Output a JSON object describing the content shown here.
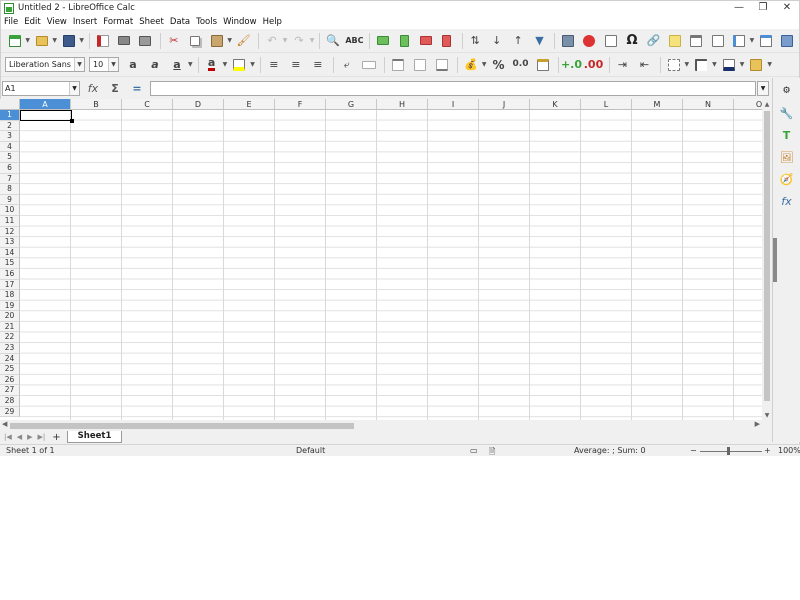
{
  "window": {
    "title": "Untitled 2 - LibreOffice Calc",
    "controls": [
      "—",
      "❐",
      "✕"
    ]
  },
  "menu": [
    "File",
    "Edit",
    "View",
    "Insert",
    "Format",
    "Sheet",
    "Data",
    "Tools",
    "Window",
    "Help"
  ],
  "format": {
    "font_name": "Liberation Sans",
    "font_size": "10"
  },
  "formula": {
    "cell_ref": "A1",
    "sum_symbol": "Σ",
    "equals_symbol": "=",
    "value": ""
  },
  "grid": {
    "columns": [
      "A",
      "B",
      "C",
      "D",
      "E",
      "F",
      "G",
      "H",
      "I",
      "J",
      "K",
      "L",
      "M",
      "N",
      "O"
    ],
    "rows": [
      "1",
      "2",
      "3",
      "4",
      "5",
      "6",
      "7",
      "8",
      "9",
      "10",
      "11",
      "12",
      "13",
      "14",
      "15",
      "16",
      "17",
      "18",
      "19",
      "20",
      "21",
      "22",
      "23",
      "24",
      "25",
      "26",
      "27",
      "28",
      "29"
    ],
    "selected_column": "A",
    "selected_row": "1"
  },
  "sheets": {
    "tabs": [
      "Sheet1"
    ],
    "active": "Sheet1"
  },
  "status": {
    "sheet_info": "Sheet 1 of 1",
    "page_style": "Default",
    "aggregate": "Average: ; Sum: 0",
    "zoom": "100%"
  },
  "colors": {
    "selection_header": "#4b8fd6",
    "font_color": "#c00000",
    "highlight_color": "#ffff00",
    "accent_green": "#3aa33a"
  }
}
